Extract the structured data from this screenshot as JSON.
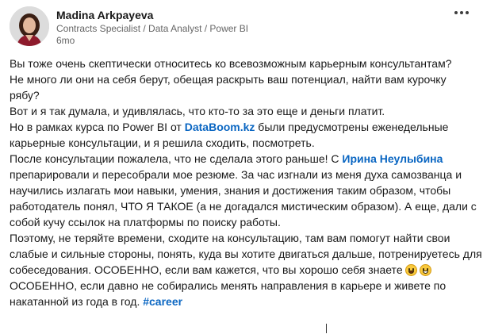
{
  "author": {
    "name": "Madina Arkpayeva",
    "headline": "Contracts Specialist / Data Analyst / Power BI",
    "time": "6mo"
  },
  "post": {
    "l1": "Вы тоже очень скептически относитесь ко всевозможным карьерным консультантам?",
    "l2": "Не много ли они на себя берут, обещая раскрыть ваш потенциал, найти вам курочку",
    "l3": "рябу?",
    "l4": "Вот и я так думала, и удивлялась, что кто-то за это еще и деньги платит.",
    "l5a": "Но в рамках курса по Power BI от ",
    "l5link": "DataBoom.kz",
    "l5b": " были предусмотрены еженедельные",
    "l6": "карьерные консультации, и я решила сходить, посмотреть.",
    "l7a": "После консультации пожалела, что не сделала этого раньше! С ",
    "l7link": "Ирина Неулыбина",
    "l8": "препарировали и пересобрали мое резюме. За час изгнали из меня духа самозванца и",
    "l9": "научились излагать мои навыки, умения, знания и достижения таким образом, чтобы",
    "l10": "работодатель понял, ЧТО Я ТАКОЕ (а не догадался мистическим образом). А еще, дали с",
    "l11": "собой кучу ссылок на платформы по поиску работы.",
    "l12": "Поэтому, не теряйте времени, сходите на консультацию, там вам помогут найти свои",
    "l13": "слабые и сильные стороны, понять, куда вы хотите двигаться дальше, потренируетесь для",
    "l14": "собеседования. ОСОБЕННО, если вам кажется, что вы хорошо себя знаете",
    "l15": "ОСОБЕННО, если давно не собирались менять направления в карьере и живете по",
    "l16a": "накатанной из года в год. ",
    "l16tag": "#career"
  },
  "icons": {
    "menu": "more-horizontal-icon",
    "emoji1": "grinning-face-emoji",
    "emoji2": "smiling-face-emoji"
  },
  "colors": {
    "link": "#0a66c2",
    "text": "#191919",
    "muted": "#666666"
  }
}
